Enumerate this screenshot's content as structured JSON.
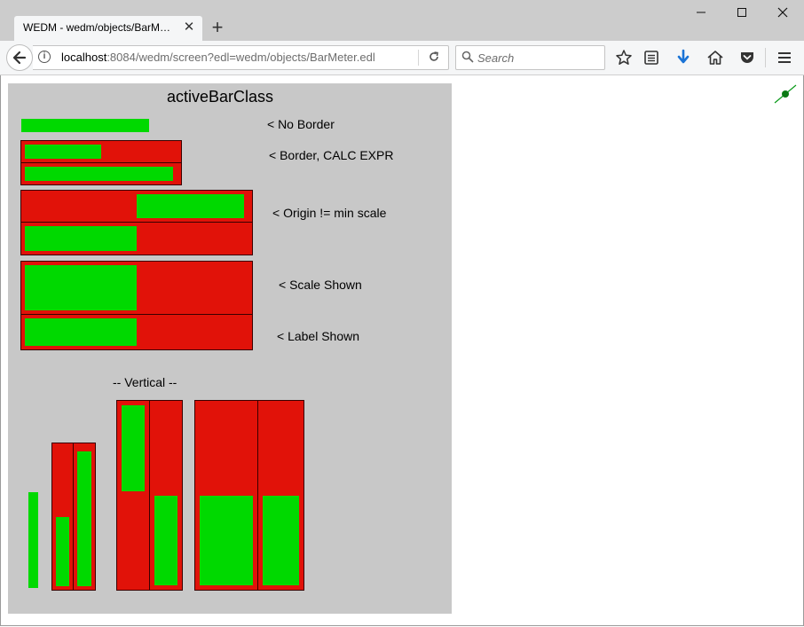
{
  "browser": {
    "tab_title": "WEDM - wedm/objects/BarM…",
    "tab_close": "✕",
    "new_tab": "+",
    "window_minimize": "—",
    "window_maximize": "☐",
    "window_close": "✕",
    "url_host": "localhost",
    "url_rest": ":8084/wedm/screen?edl=wedm/objects/BarMeter.edl",
    "search_placeholder": "Search",
    "toolbar_icons": [
      "star-icon",
      "reading-list-icon",
      "download-icon",
      "home-icon",
      "pocket-icon",
      "menu-icon"
    ]
  },
  "colors": {
    "screen_bg": "#c8c8c8",
    "bar_bg": "#e11209",
    "bar_fill": "#00d900",
    "bar_border": "#3a0000",
    "download_blue": "#1a73d6",
    "status_green": "#0a9a1a"
  },
  "screen": {
    "title": "activeBarClass",
    "labels": {
      "no_border": "< No Border",
      "border_calc": "< Border, CALC EXPR",
      "origin": "< Origin != min scale",
      "scale_shown": "< Scale Shown",
      "label_shown": "< Label Shown",
      "vertical": "-- Vertical --"
    },
    "meters": {
      "no_border": 0.9,
      "border_calc_1": 0.5,
      "border_calc_2": 0.97,
      "origin_1": 0.5,
      "origin_2": 0.5,
      "scale_shown": 0.5,
      "label_shown": 0.5,
      "vertical_no_border": 1.0,
      "vertical_small_1": 0.5,
      "vertical_small_2": 0.97,
      "vertical_origin_1": 0.5,
      "vertical_origin_2": 0.5,
      "vertical_large_1": 0.5,
      "vertical_large_2": 0.5
    }
  }
}
